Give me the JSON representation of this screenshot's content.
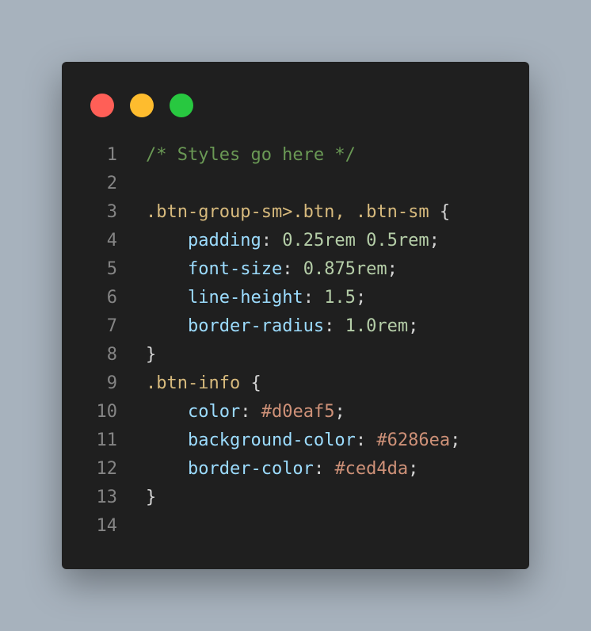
{
  "window": {
    "dots": [
      {
        "name": "close-dot",
        "color": "#ff5f57"
      },
      {
        "name": "minimize-dot",
        "color": "#febc2e"
      },
      {
        "name": "maximize-dot",
        "color": "#28c840"
      }
    ]
  },
  "code": {
    "lines": [
      {
        "n": "1",
        "tokens": [
          {
            "t": "/* Styles go here */",
            "k": "comment"
          }
        ]
      },
      {
        "n": "2",
        "tokens": []
      },
      {
        "n": "3",
        "tokens": [
          {
            "t": ".btn-group-sm>.btn, .btn-sm",
            "k": "sel"
          },
          {
            "t": " {",
            "k": "punct"
          }
        ]
      },
      {
        "n": "4",
        "tokens": [
          {
            "t": "    ",
            "k": "punct"
          },
          {
            "t": "padding",
            "k": "prop"
          },
          {
            "t": ": ",
            "k": "punct"
          },
          {
            "t": "0.25rem 0.5rem",
            "k": "num"
          },
          {
            "t": ";",
            "k": "punct"
          }
        ]
      },
      {
        "n": "5",
        "tokens": [
          {
            "t": "    ",
            "k": "punct"
          },
          {
            "t": "font-size",
            "k": "prop"
          },
          {
            "t": ": ",
            "k": "punct"
          },
          {
            "t": "0.875rem",
            "k": "num"
          },
          {
            "t": ";",
            "k": "punct"
          }
        ]
      },
      {
        "n": "6",
        "tokens": [
          {
            "t": "    ",
            "k": "punct"
          },
          {
            "t": "line-height",
            "k": "prop"
          },
          {
            "t": ": ",
            "k": "punct"
          },
          {
            "t": "1.5",
            "k": "num"
          },
          {
            "t": ";",
            "k": "punct"
          }
        ]
      },
      {
        "n": "7",
        "tokens": [
          {
            "t": "    ",
            "k": "punct"
          },
          {
            "t": "border-radius",
            "k": "prop"
          },
          {
            "t": ": ",
            "k": "punct"
          },
          {
            "t": "1.0rem",
            "k": "num"
          },
          {
            "t": ";",
            "k": "punct"
          }
        ]
      },
      {
        "n": "8",
        "tokens": [
          {
            "t": "}",
            "k": "punct"
          }
        ]
      },
      {
        "n": "9",
        "tokens": [
          {
            "t": ".btn-info",
            "k": "sel"
          },
          {
            "t": " {",
            "k": "punct"
          }
        ]
      },
      {
        "n": "10",
        "tokens": [
          {
            "t": "    ",
            "k": "punct"
          },
          {
            "t": "color",
            "k": "prop"
          },
          {
            "t": ": ",
            "k": "punct"
          },
          {
            "t": "#d0eaf5",
            "k": "color"
          },
          {
            "t": ";",
            "k": "punct"
          }
        ]
      },
      {
        "n": "11",
        "tokens": [
          {
            "t": "    ",
            "k": "punct"
          },
          {
            "t": "background-color",
            "k": "prop"
          },
          {
            "t": ": ",
            "k": "punct"
          },
          {
            "t": "#6286ea",
            "k": "color"
          },
          {
            "t": ";",
            "k": "punct"
          }
        ]
      },
      {
        "n": "12",
        "tokens": [
          {
            "t": "    ",
            "k": "punct"
          },
          {
            "t": "border-color",
            "k": "prop"
          },
          {
            "t": ": ",
            "k": "punct"
          },
          {
            "t": "#ced4da",
            "k": "color"
          },
          {
            "t": ";",
            "k": "punct"
          }
        ]
      },
      {
        "n": "13",
        "tokens": [
          {
            "t": "}",
            "k": "punct"
          }
        ]
      },
      {
        "n": "14",
        "tokens": []
      }
    ]
  }
}
